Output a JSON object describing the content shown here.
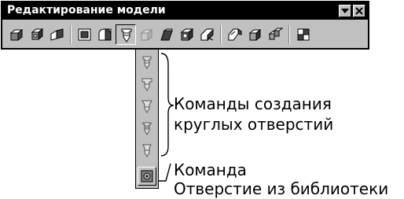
{
  "window": {
    "title": "Редактирование модели",
    "controls": [
      "dropdown-arrow-icon",
      "close-x-icon"
    ]
  },
  "toolbar": {
    "buttons": [
      {
        "icon": "extrude-icon"
      },
      {
        "icon": "rotate-icon"
      },
      {
        "icon": "kinematic-icon"
      },
      {
        "icon": "loft-icon"
      },
      {
        "icon": "fillet-icon"
      },
      {
        "icon": "hole-icon",
        "state": "pressed"
      },
      {
        "icon": "cut-extrude-icon",
        "state": "disabled"
      },
      {
        "icon": "cut-rotate-icon"
      },
      {
        "icon": "shell-icon"
      },
      {
        "icon": "draft-icon"
      },
      {
        "icon": "rib-icon"
      },
      {
        "icon": "array-icon"
      },
      {
        "icon": "mirror-icon"
      },
      {
        "icon": "component-icon"
      }
    ]
  },
  "flyout": {
    "items": [
      {
        "icon": "round-hole-1-icon"
      },
      {
        "icon": "round-hole-2-icon"
      },
      {
        "icon": "round-hole-3-icon"
      },
      {
        "icon": "round-hole-4-icon"
      },
      {
        "icon": "round-hole-5-icon"
      },
      {
        "icon": "library-hole-icon"
      }
    ]
  },
  "annotations": {
    "round_holes_line1": "Команды создания",
    "round_holes_line2": "круглых отверстий",
    "library_line1": "Команда",
    "library_line2": "Отверстие из библиотеки"
  }
}
